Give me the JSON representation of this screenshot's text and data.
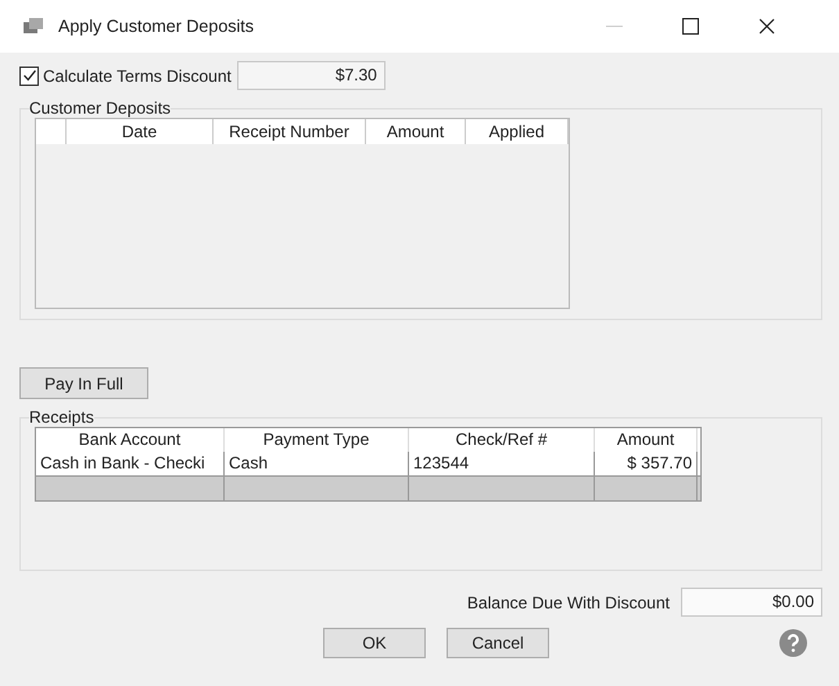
{
  "window": {
    "title": "Apply Customer Deposits",
    "minimize_disabled": true
  },
  "terms_discount": {
    "label": "Calculate Terms Discount",
    "checked": true,
    "value": "$7.30"
  },
  "customer_deposits": {
    "title": "Customer Deposits",
    "columns": [
      "Date",
      "Receipt Number",
      "Amount",
      "Applied"
    ]
  },
  "pay_in_full_button": "Pay In Full",
  "receipts": {
    "title": "Receipts",
    "columns": [
      "Bank Account",
      "Payment Type",
      "Check/Ref #",
      "Amount"
    ],
    "rows": [
      {
        "cells": [
          "Cash in Bank - Checki",
          "Cash",
          "123544",
          "$ 357.70"
        ],
        "selected": false
      },
      {
        "cells": [
          "",
          "",
          "",
          ""
        ],
        "selected": true
      }
    ]
  },
  "balance": {
    "label": "Balance Due With Discount",
    "value": "$0.00"
  },
  "buttons": [
    "OK",
    "Cancel"
  ]
}
